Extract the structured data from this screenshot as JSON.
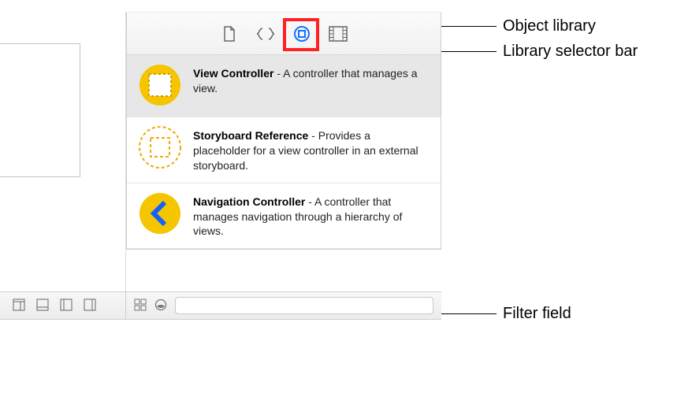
{
  "selector": {
    "icons": [
      "file-template-icon",
      "code-snippet-icon",
      "object-library-icon",
      "media-library-icon"
    ]
  },
  "library": {
    "items": [
      {
        "title": "View Controller",
        "desc": "A controller that manages a view.",
        "selected": true,
        "icon": "view-controller-icon"
      },
      {
        "title": "Storyboard Reference",
        "desc": "Provides a placeholder for a view controller in an external storyboard.",
        "selected": false,
        "icon": "storyboard-reference-icon"
      },
      {
        "title": "Navigation Controller",
        "desc": "A controller that manages navigation through a hierarchy of views.",
        "selected": false,
        "icon": "navigation-controller-icon"
      }
    ]
  },
  "filter": {
    "placeholder": ""
  },
  "callouts": {
    "object_library": "Object library",
    "library_selector_bar": "Library selector bar",
    "filter_field": "Filter field"
  }
}
